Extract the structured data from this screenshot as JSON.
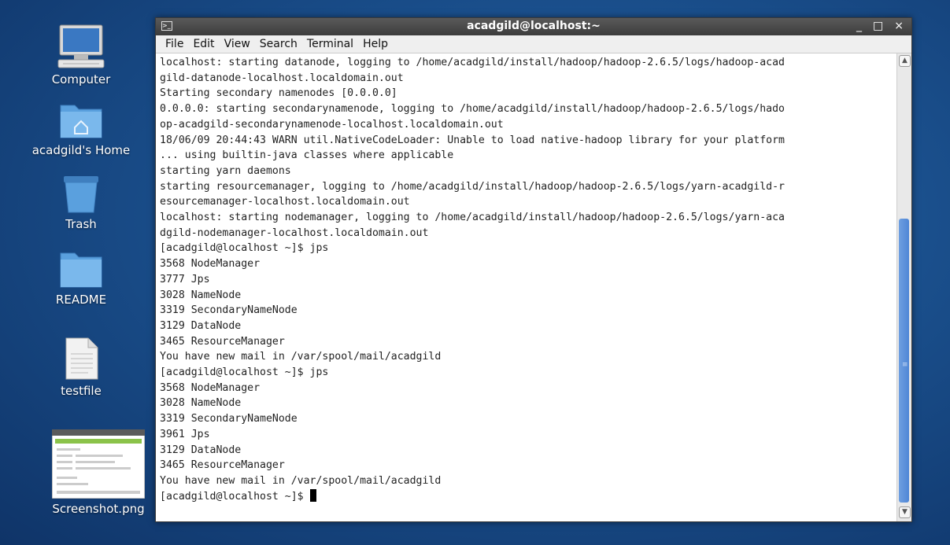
{
  "window": {
    "title": "acadgild@localhost:~",
    "controls": {
      "minimize": "_",
      "maximize": "□",
      "close": "×"
    }
  },
  "menu": [
    "File",
    "Edit",
    "View",
    "Search",
    "Terminal",
    "Help"
  ],
  "desktop": {
    "icons": [
      {
        "label": "Computer",
        "icon": "computer-icon"
      },
      {
        "label": "acadgild's Home",
        "icon": "home-folder-icon"
      },
      {
        "label": "Trash",
        "icon": "trash-icon"
      },
      {
        "label": "README",
        "icon": "folder-icon"
      },
      {
        "label": "testfile",
        "icon": "document-icon"
      },
      {
        "label": "Screenshot.png",
        "icon": "image-thumbnail-icon"
      }
    ]
  },
  "terminal": {
    "lines": [
      "localhost: starting datanode, logging to /home/acadgild/install/hadoop/hadoop-2.6.5/logs/hadoop-acad",
      "gild-datanode-localhost.localdomain.out",
      "Starting secondary namenodes [0.0.0.0]",
      "0.0.0.0: starting secondarynamenode, logging to /home/acadgild/install/hadoop/hadoop-2.6.5/logs/hado",
      "op-acadgild-secondarynamenode-localhost.localdomain.out",
      "18/06/09 20:44:43 WARN util.NativeCodeLoader: Unable to load native-hadoop library for your platform",
      "... using builtin-java classes where applicable",
      "starting yarn daemons",
      "starting resourcemanager, logging to /home/acadgild/install/hadoop/hadoop-2.6.5/logs/yarn-acadgild-r",
      "esourcemanager-localhost.localdomain.out",
      "localhost: starting nodemanager, logging to /home/acadgild/install/hadoop/hadoop-2.6.5/logs/yarn-aca",
      "dgild-nodemanager-localhost.localdomain.out",
      "[acadgild@localhost ~]$ jps",
      "3568 NodeManager",
      "3777 Jps",
      "3028 NameNode",
      "3319 SecondaryNameNode",
      "3129 DataNode",
      "3465 ResourceManager",
      "You have new mail in /var/spool/mail/acadgild",
      "[acadgild@localhost ~]$ jps",
      "3568 NodeManager",
      "3028 NameNode",
      "3319 SecondaryNameNode",
      "3961 Jps",
      "3129 DataNode",
      "3465 ResourceManager",
      "You have new mail in /var/spool/mail/acadgild"
    ],
    "prompt": "[acadgild@localhost ~]$ "
  }
}
